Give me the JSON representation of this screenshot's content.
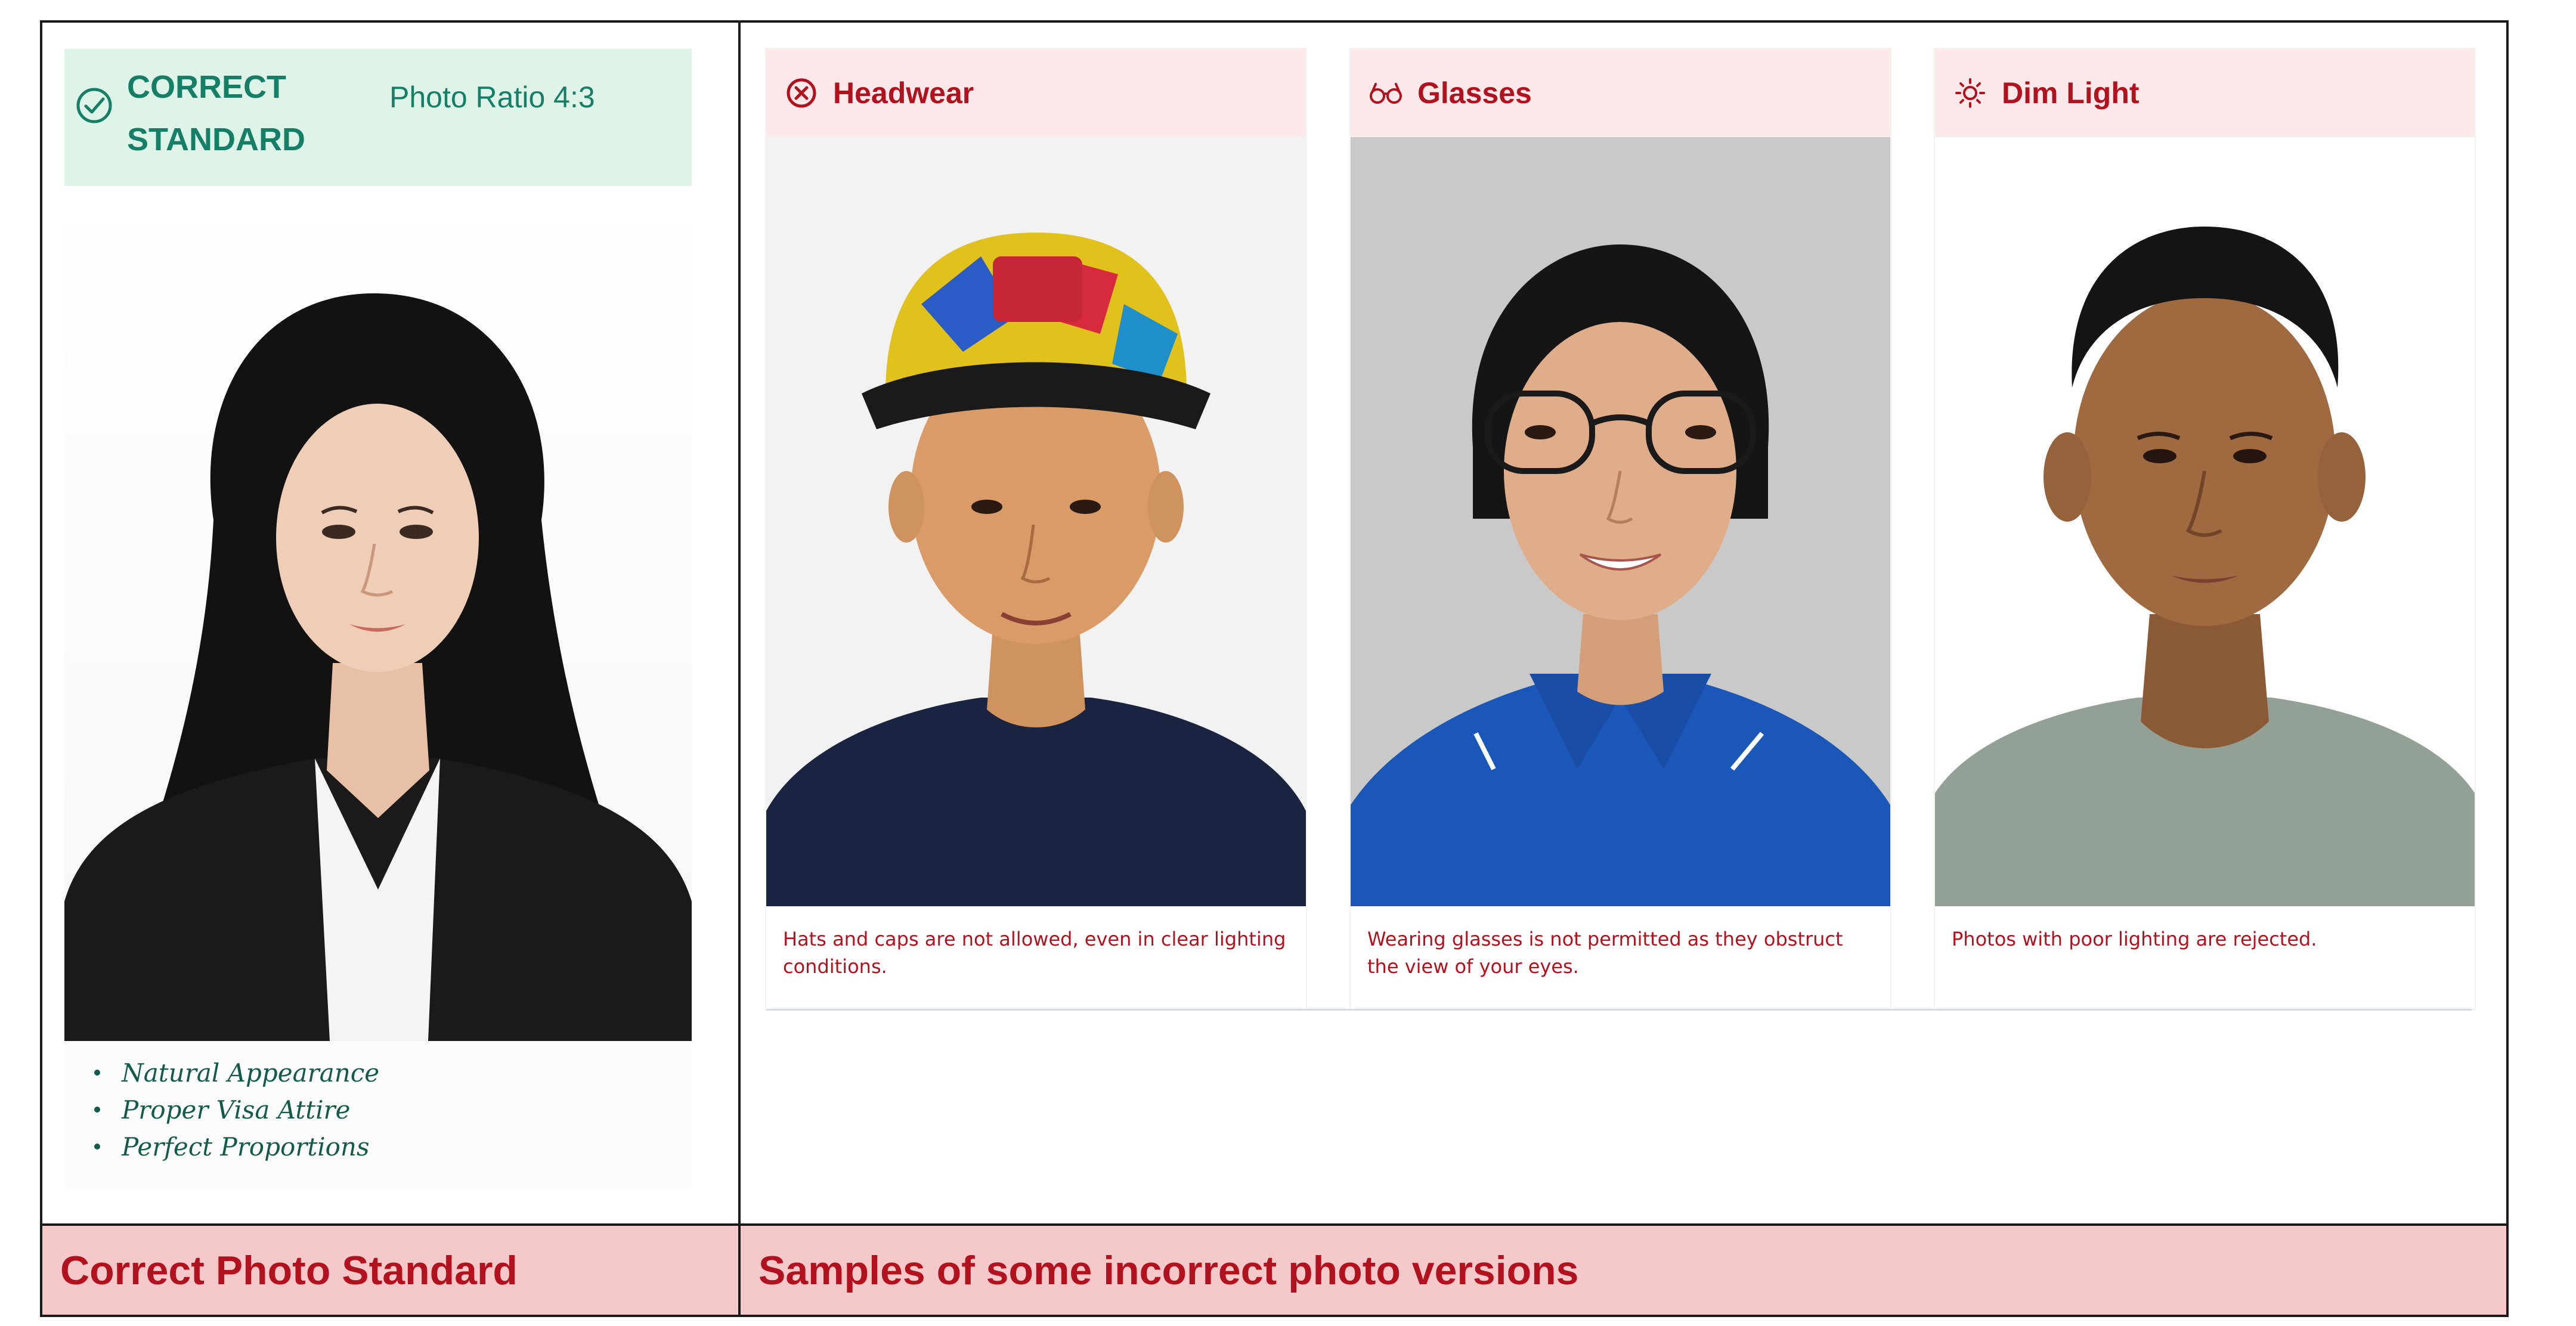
{
  "correct_panel": {
    "badge_title": "CORRECT STANDARD",
    "ratio_label": "Photo Ratio 4:3",
    "features": [
      "Natural Appearance",
      "Proper Visa Attire",
      "Perfect Proportions"
    ],
    "footer": "Correct Photo Standard"
  },
  "samples": [
    {
      "icon": "x-circle-icon",
      "title": "Headwear",
      "description": "Hats and caps are not allowed, even in clear lighting conditions."
    },
    {
      "icon": "glasses-icon",
      "title": "Glasses",
      "description": "Wearing glasses is not permitted as they obstruct the view of your eyes."
    },
    {
      "icon": "sun-dim-icon",
      "title": "Dim Light",
      "description": "Photos with poor lighting are rejected."
    }
  ],
  "samples_footer": "Samples of some incorrect photo versions",
  "colors": {
    "accent_green": "#157e66",
    "accent_red": "#b1121d",
    "header_green_bg": "#dff4e8",
    "header_red_bg": "#fde9e9",
    "footer_bg": "#f5c9c9"
  }
}
